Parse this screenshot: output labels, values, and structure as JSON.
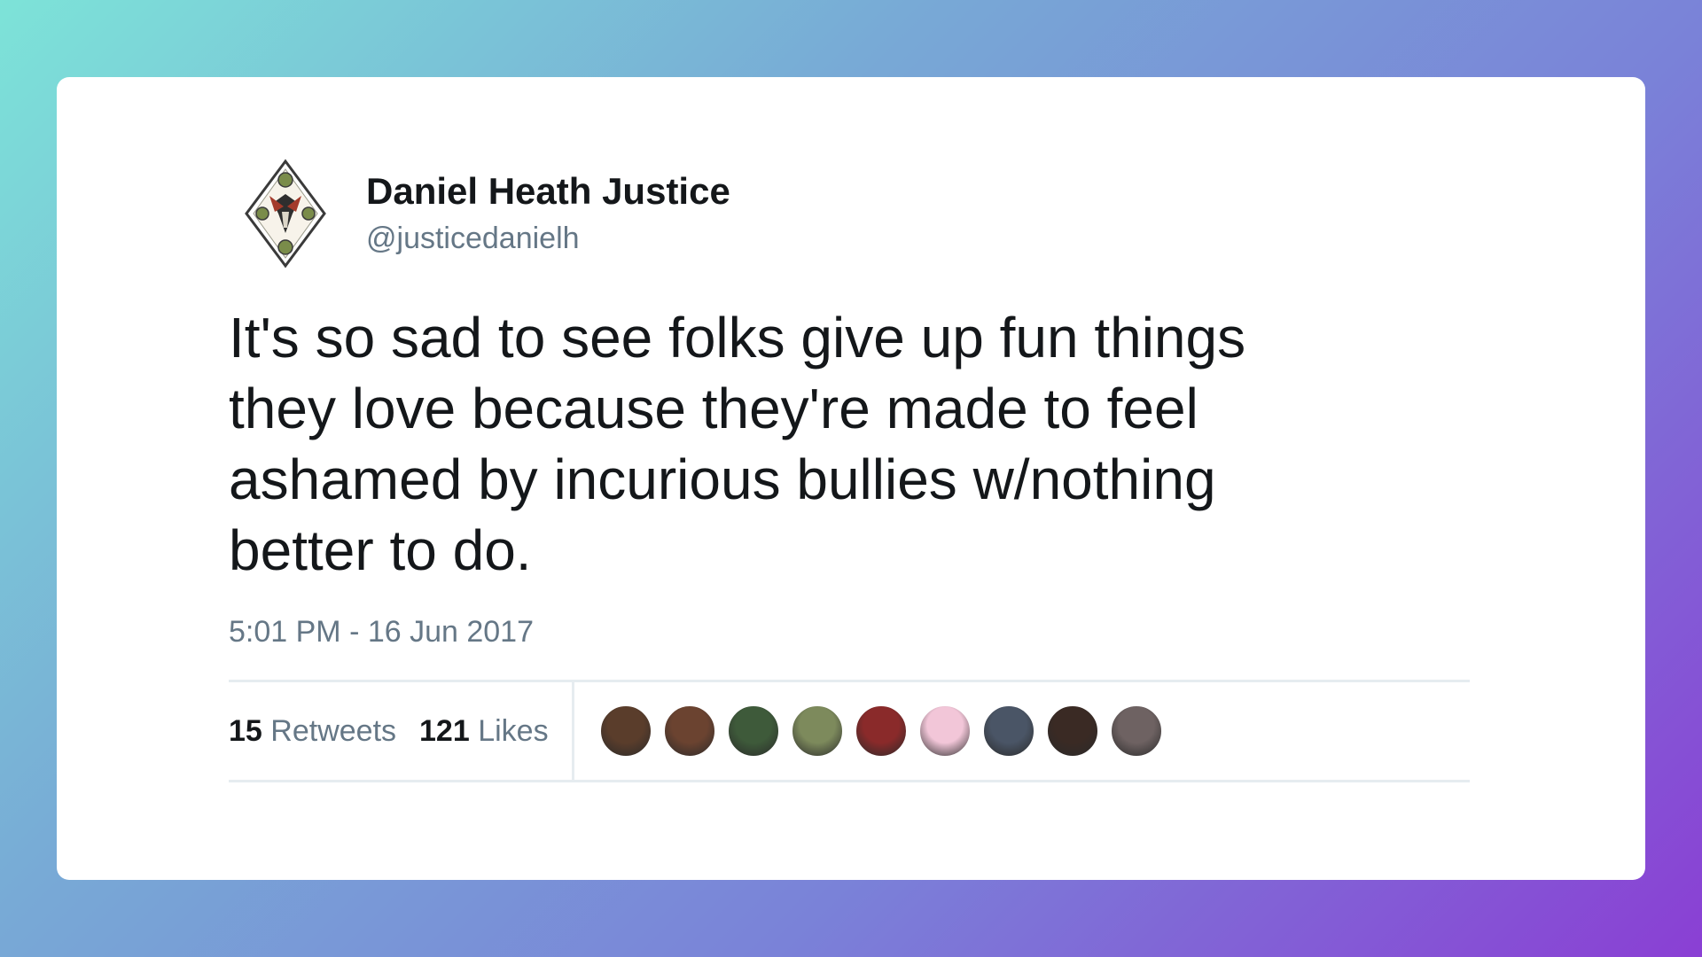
{
  "tweet": {
    "author": {
      "display_name": "Daniel Heath Justice",
      "handle": "@justicedanielh",
      "avatar_icon": "diamond-emblem-avatar"
    },
    "text": "It's so sad to see folks give up fun things\nthey love because they're made to feel\nashamed by incurious bullies w/nothing\nbetter to do.",
    "timestamp": "5:01 PM - 16 Jun 2017",
    "stats": {
      "retweets_count": "15",
      "retweets_label": "Retweets",
      "likes_count": "121",
      "likes_label": "Likes"
    },
    "likers": [
      {
        "color": "#5a3d2b"
      },
      {
        "color": "#6b4330"
      },
      {
        "color": "#3e5a3a"
      },
      {
        "color": "#7d8a5c"
      },
      {
        "color": "#8a2a2a"
      },
      {
        "color": "#f2c6d8"
      },
      {
        "color": "#4a5566"
      },
      {
        "color": "#3a2a24"
      },
      {
        "color": "#6e6262"
      }
    ]
  },
  "colors": {
    "primary_text": "#14171a",
    "secondary_text": "#657786",
    "divider": "#e6ecf0",
    "card_background": "#ffffff"
  }
}
